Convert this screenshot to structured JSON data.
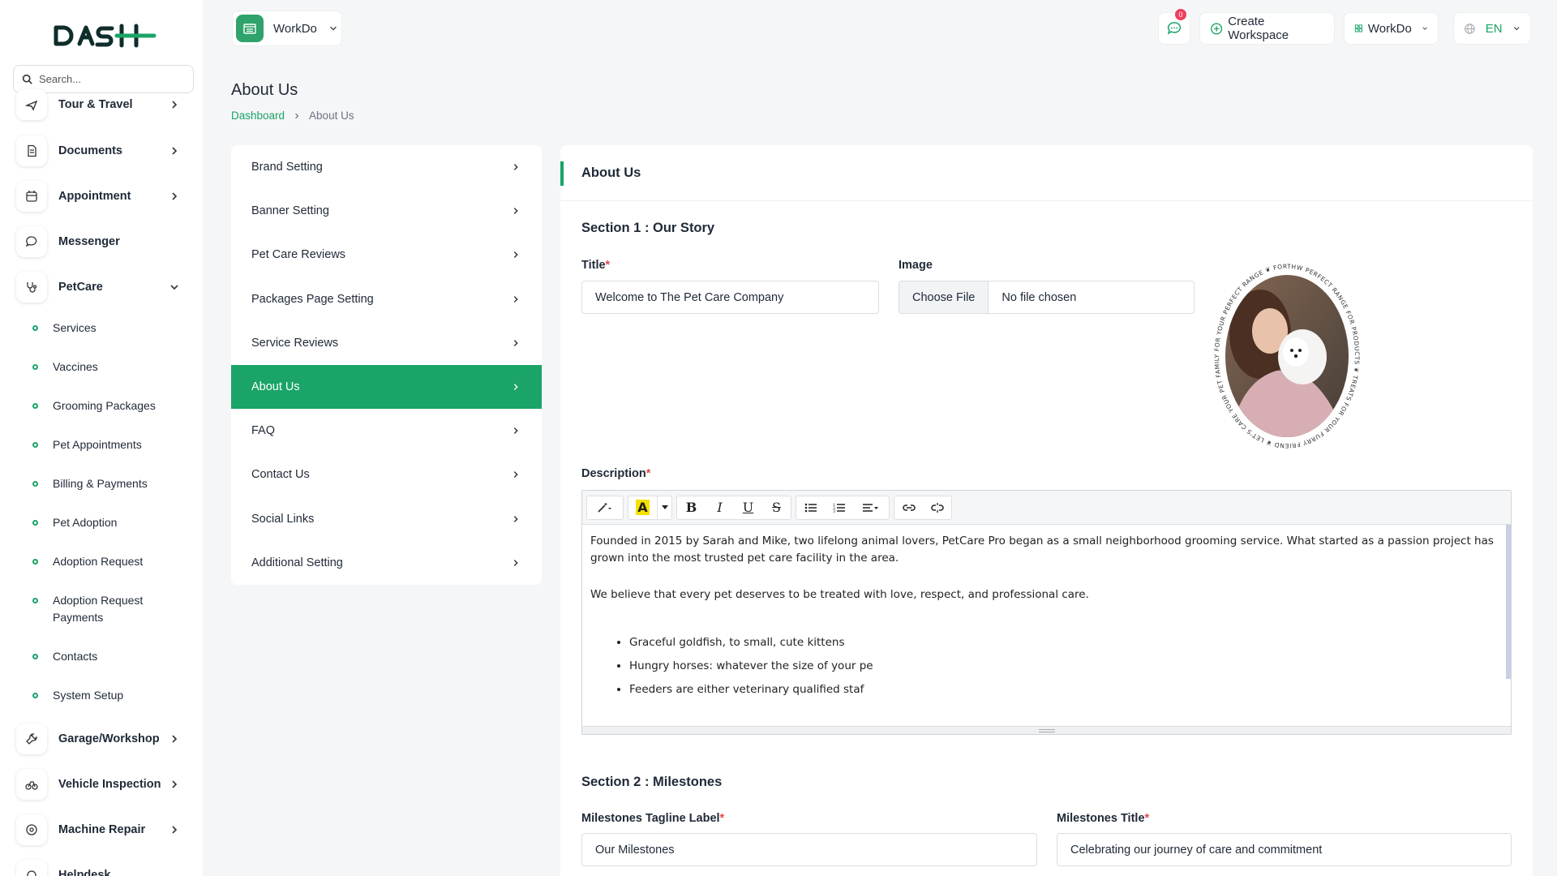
{
  "sidebar": {
    "search_placeholder": "Search...",
    "items_top": [
      {
        "label": "Tour & Travel",
        "icon": "plane-icon"
      },
      {
        "label": "Documents",
        "icon": "document-icon"
      },
      {
        "label": "Appointment",
        "icon": "calendar-icon"
      },
      {
        "label": "Messenger",
        "icon": "chat-icon"
      },
      {
        "label": "PetCare",
        "icon": "stethoscope-icon"
      }
    ],
    "sub_items": [
      "Services",
      "Vaccines",
      "Grooming Packages",
      "Pet Appointments",
      "Billing & Payments",
      "Pet Adoption",
      "Adoption Request",
      "Adoption Request Payments",
      "Contacts",
      "System Setup"
    ],
    "items_bottom": [
      {
        "label": "Garage/Workshop",
        "icon": "wrench-icon"
      },
      {
        "label": "Vehicle Inspection",
        "icon": "bike-icon"
      },
      {
        "label": "Machine Repair",
        "icon": "machine-icon"
      },
      {
        "label": "Helpdesk",
        "icon": "headset-icon"
      }
    ]
  },
  "header": {
    "workspace_name": "WorkDo",
    "notification_count": "0",
    "create_workspace_label": "Create Workspace",
    "workspace_menu_label": "WorkDo",
    "language_label": "EN"
  },
  "page": {
    "title": "About Us",
    "breadcrumb_home": "Dashboard",
    "breadcrumb_current": "About Us"
  },
  "settings_menu": [
    "Brand Setting",
    "Banner Setting",
    "Pet Care Reviews",
    "Packages Page Setting",
    "Service Reviews",
    "About Us",
    "FAQ",
    "Contact Us",
    "Social Links",
    "Additional Setting"
  ],
  "settings_menu_active": "About Us",
  "form": {
    "card_title": "About Us",
    "section1_title": "Section 1 : Our Story",
    "title_label": "Title",
    "title_value": "Welcome to The Pet Care Company",
    "image_label": "Image",
    "choose_file_label": "Choose File",
    "no_file_label": "No file chosen",
    "badge_ring_text": "THW PERFECT RANGE FOR PRODUCTS ❦ TREATS FOR YOUR FURRY FRIEND ❦ LET'S CARE YOUR PET FAMILY FOR YOUR PERFECT RANGE ❦ FOR PET PRODUCTS",
    "description_label": "Description",
    "description_p1": "Founded in 2015 by Sarah and Mike, two lifelong animal lovers, PetCare Pro began as a small neighborhood grooming service. What started as a passion project has grown into the most trusted pet care facility in the area.",
    "description_p2": "We believe that every pet deserves to be treated with love, respect, and professional care.",
    "description_list": [
      "Graceful goldfish, to small, cute kittens",
      "Hungry horses: whatever the size of your pe",
      "Feeders are either veterinary qualified staf"
    ],
    "section2_title": "Section 2 : Milestones",
    "milestones_tagline_label": "Milestones Tagline Label",
    "milestones_tagline_value": "Our Milestones",
    "milestones_title_label": "Milestones Title",
    "milestones_title_value": "Celebrating our journey of care and commitment"
  },
  "colors": {
    "accent": "#1aa467",
    "danger": "#e5484d"
  }
}
